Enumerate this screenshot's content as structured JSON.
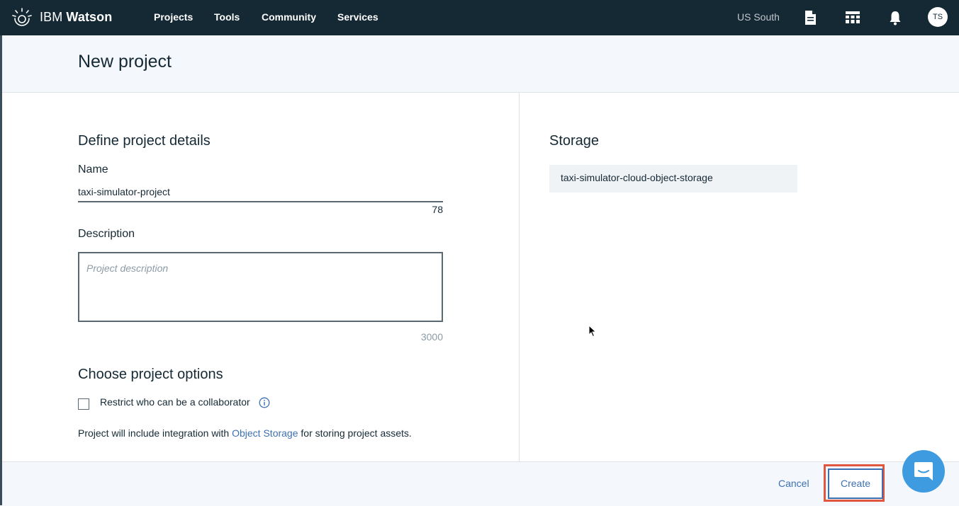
{
  "topbar": {
    "brand_light": "IBM",
    "brand_bold": "Watson",
    "nav": [
      "Projects",
      "Tools",
      "Community",
      "Services"
    ],
    "region": "US South",
    "icons": [
      "document-icon",
      "apps-grid-icon",
      "notification-bell-icon"
    ],
    "avatar_initials": "TS"
  },
  "page": {
    "title": "New project"
  },
  "details": {
    "section_title": "Define project details",
    "name_label": "Name",
    "name_value": "taxi-simulator-project",
    "name_counter": "78",
    "description_label": "Description",
    "description_placeholder": "Project description",
    "description_counter": "3000"
  },
  "options": {
    "section_title": "Choose project options",
    "restrict_label": "Restrict who can be a collaborator",
    "restrict_checked": false,
    "note_prefix": "Project will include integration with ",
    "note_link": "Object Storage",
    "note_suffix": " for storing project assets."
  },
  "storage": {
    "section_title": "Storage",
    "instance": "taxi-simulator-cloud-object-storage"
  },
  "footer": {
    "cancel_label": "Cancel",
    "create_label": "Create"
  },
  "colors": {
    "topbar": "#152935",
    "accent": "#3d70b2",
    "highlight": "#e0563e",
    "chat": "#3e9bdf"
  }
}
